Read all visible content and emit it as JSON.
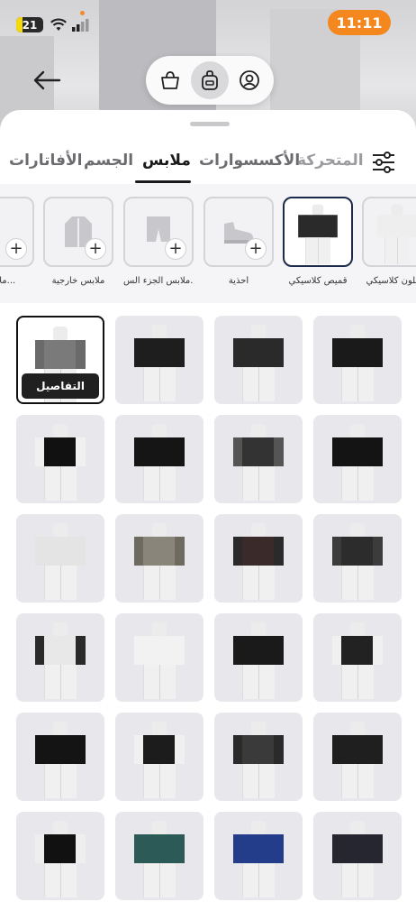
{
  "status_bar": {
    "battery": "21",
    "time": "11:11"
  },
  "colors": {
    "accent": "#f5871f",
    "selected_border": "#1c2b4a",
    "details_bg": "#202020"
  },
  "mode_switch": {
    "icons": [
      "shopping-bag-icon",
      "backpack-icon",
      "user-circle-icon"
    ],
    "active": "backpack-icon"
  },
  "tabs": {
    "items": [
      "الأفاتارات",
      "الجسم",
      "ملابس",
      "الأكسسوارات",
      "المتحركة"
    ],
    "active": "ملابس"
  },
  "subcategories": [
    {
      "label": "ملابس...",
      "selected": false
    },
    {
      "label": "ملابس خارجية",
      "selected": false
    },
    {
      "label": "ملابس الجزء الس...",
      "selected": false
    },
    {
      "label": "أحذية",
      "selected": false
    },
    {
      "label": "قميص كلاسيكي",
      "selected": true
    },
    {
      "label": "بنطلون كلاسيكي",
      "selected": false
    }
  ],
  "grid": {
    "details_label": "التفاصيل",
    "items": [
      {
        "shirt": "#7a7a7a",
        "sleeve": "#6a6a6a",
        "selected": true
      },
      {
        "shirt": "#1e1e1e",
        "sleeve": "#1e1e1e"
      },
      {
        "shirt": "#2a2a2a",
        "sleeve": "#2a2a2a"
      },
      {
        "shirt": "#1a1a1a",
        "sleeve": "#1a1a1a"
      },
      {
        "shirt": "#111111",
        "sleeve": "#f0f0f0"
      },
      {
        "shirt": "#151515",
        "sleeve": "#151515"
      },
      {
        "shirt": "#333333",
        "sleeve": "#555555"
      },
      {
        "shirt": "#141414",
        "sleeve": "#141414"
      },
      {
        "shirt": "#e4e4e4",
        "sleeve": "#e4e4e4"
      },
      {
        "shirt": "#8a857a",
        "sleeve": "#6e6a60"
      },
      {
        "shirt": "#3a2a2a",
        "sleeve": "#2a2a2a"
      },
      {
        "shirt": "#2c2c2c",
        "sleeve": "#3c3c3c"
      },
      {
        "shirt": "#e8e8e8",
        "sleeve": "#2a2a2a"
      },
      {
        "shirt": "#f2f2f2",
        "sleeve": "#f2f2f2"
      },
      {
        "shirt": "#1a1a1a",
        "sleeve": "#1a1a1a"
      },
      {
        "shirt": "#222222",
        "sleeve": "#f0f0f0"
      },
      {
        "shirt": "#141414",
        "sleeve": "#141414"
      },
      {
        "shirt": "#1c1c1c",
        "sleeve": "#f0f0f0"
      },
      {
        "shirt": "#3a3a3a",
        "sleeve": "#2a2a2a"
      },
      {
        "shirt": "#1f1f1f",
        "sleeve": "#1f1f1f"
      },
      {
        "shirt": "#111111",
        "sleeve": "#eeeeee"
      },
      {
        "shirt": "#2b5a57",
        "sleeve": "#2b5a57"
      },
      {
        "shirt": "#233d8a",
        "sleeve": "#233d8a"
      },
      {
        "shirt": "#262630",
        "sleeve": "#262630"
      }
    ]
  }
}
